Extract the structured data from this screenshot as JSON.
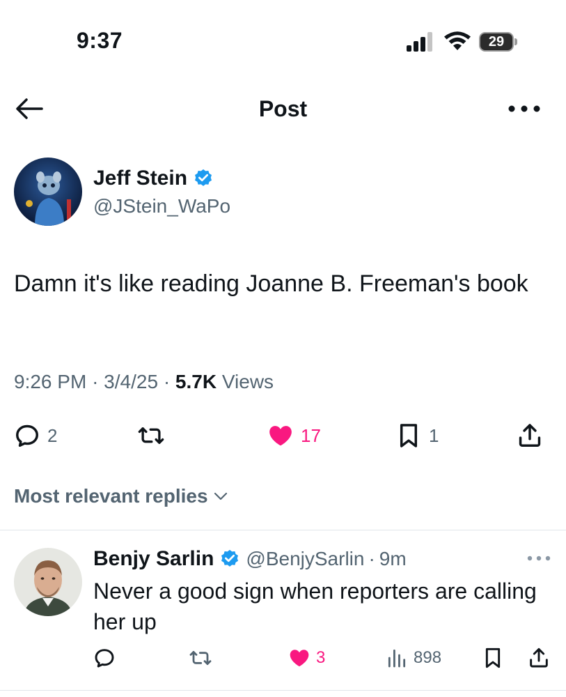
{
  "status_bar": {
    "time": "9:37",
    "battery": "29",
    "icons": [
      "cellular-signal-icon",
      "wifi-icon",
      "battery-icon"
    ]
  },
  "header": {
    "title": "Post",
    "back_icon": "arrow-left-icon",
    "more_icon": "more-horizontal-icon"
  },
  "tweet": {
    "author_name": "Jeff Stein",
    "author_handle": "@JStein_WaPo",
    "verified": true,
    "text": "Damn it's like reading Joanne B. Freeman's book",
    "time": "9:26 PM",
    "date": "3/4/25",
    "views": "5.7K",
    "views_label": "Views",
    "separator": "·",
    "counts": {
      "replies": "2",
      "retweets": "",
      "likes": "17",
      "bookmarks": "1"
    },
    "liked": true
  },
  "replies_filter": {
    "label": "Most relevant replies"
  },
  "reply": {
    "author_name": "Benjy Sarlin",
    "author_handle": "@BenjySarlin",
    "separator": "·",
    "time": "9m",
    "verified": true,
    "text": "Never a good sign when reporters are calling her up",
    "counts": {
      "replies": "",
      "retweets": "",
      "likes": "3",
      "views": "898"
    },
    "liked": true
  },
  "colors": {
    "text_primary": "#0f1419",
    "text_secondary": "#536471",
    "like_pink": "#f91880",
    "verified_blue": "#1d9bf0",
    "divider": "#e1e6ea"
  }
}
